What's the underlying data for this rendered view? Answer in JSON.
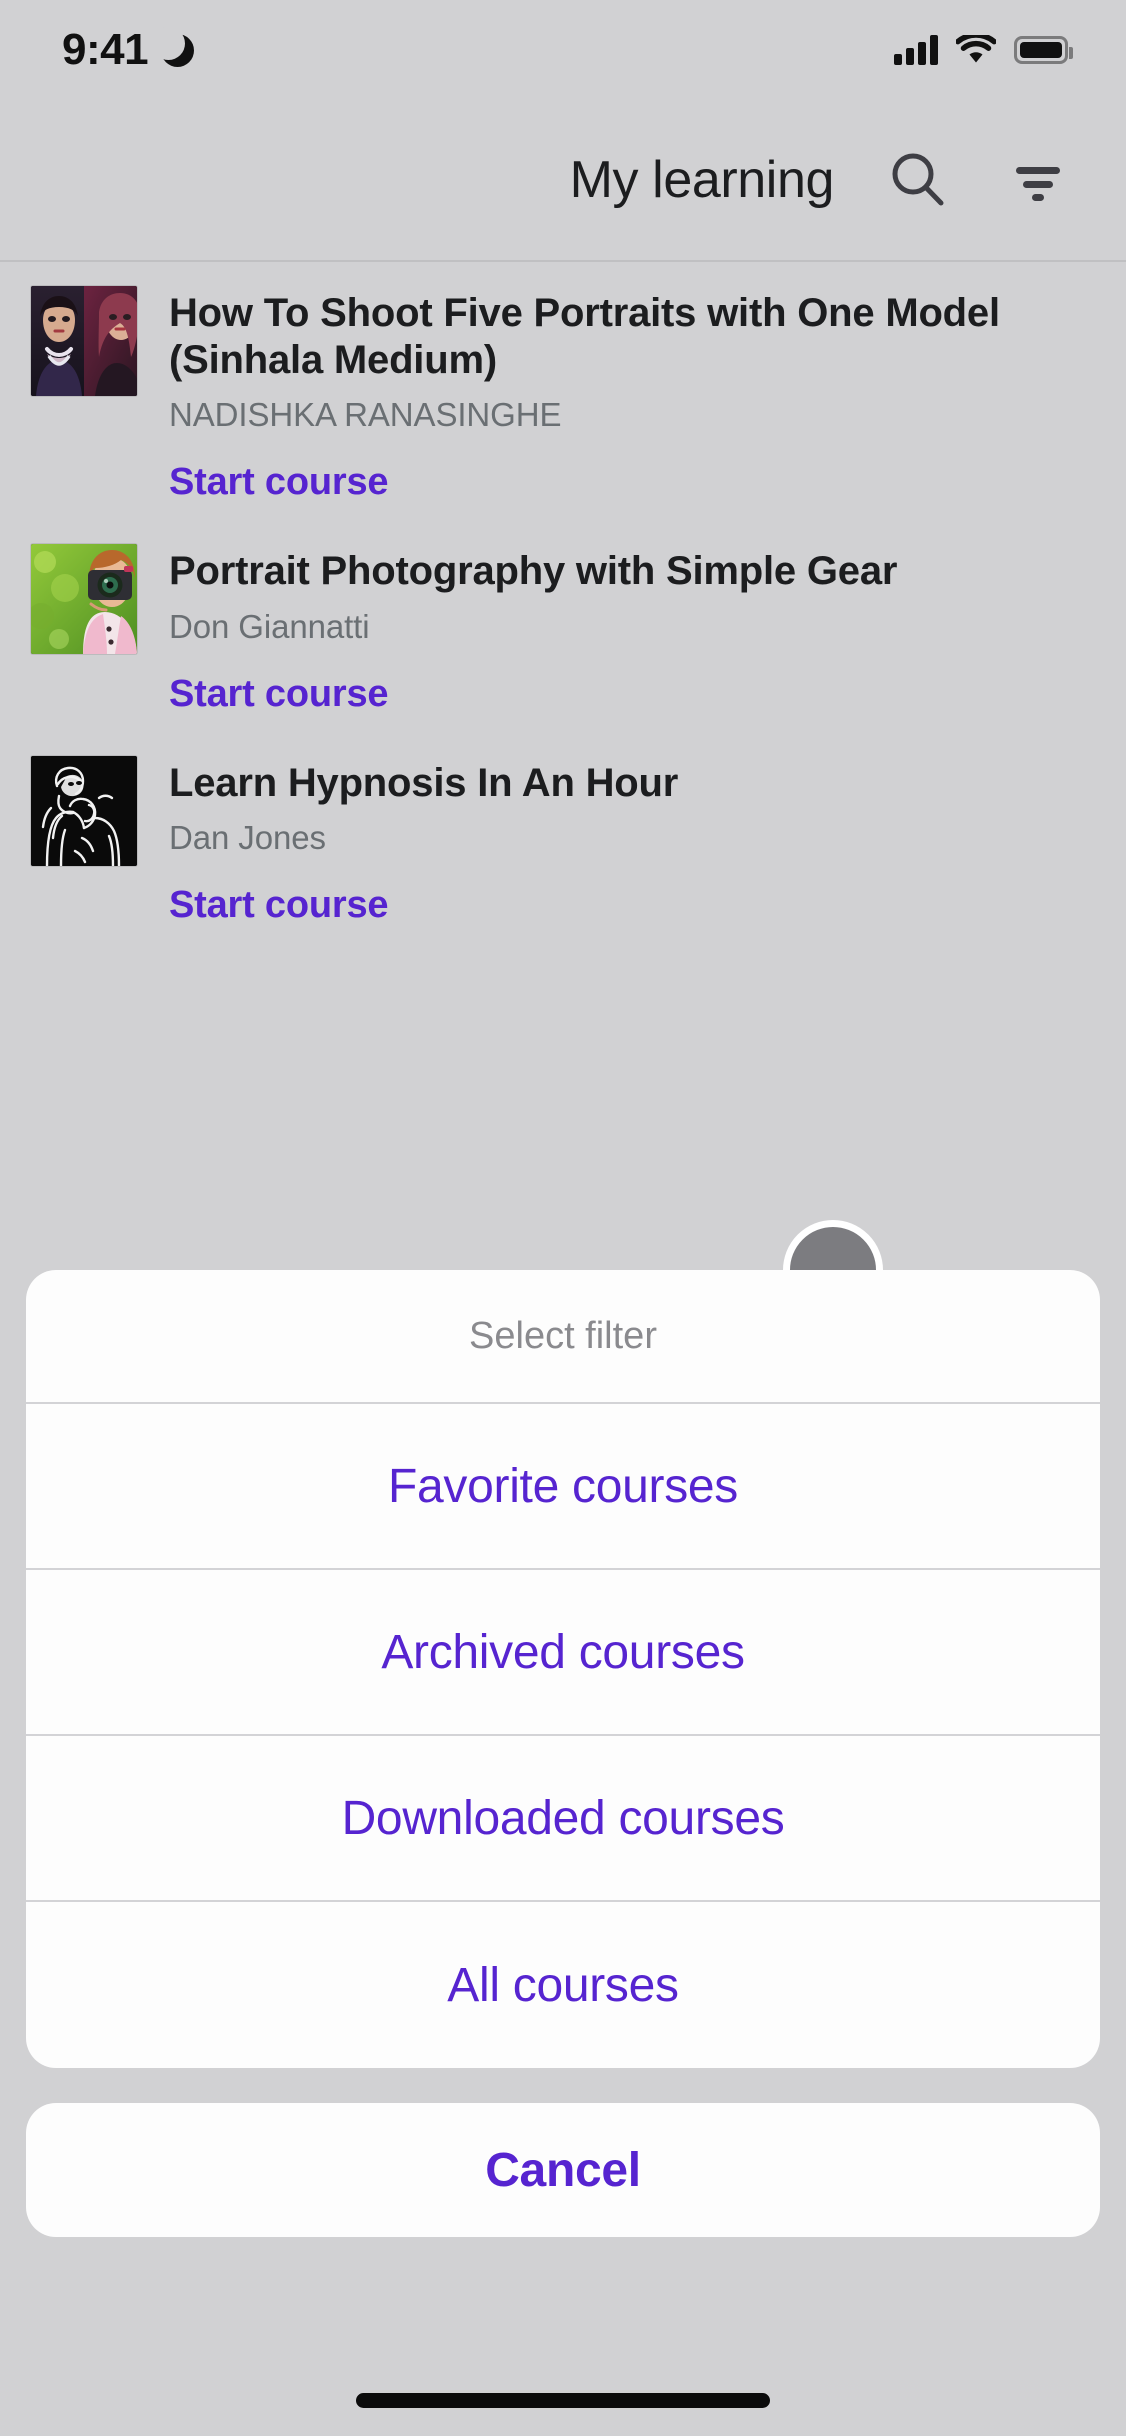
{
  "status_bar": {
    "time": "9:41",
    "dnd_icon": "moon-icon",
    "signal_icon": "cellular-signal-icon",
    "wifi_icon": "wifi-icon",
    "battery_icon": "battery-full-icon"
  },
  "header": {
    "title": "My learning",
    "search_icon": "search-icon",
    "filter_icon": "filter-icon"
  },
  "courses": [
    {
      "title": "How To Shoot Five Portraits with One Model (Sinhala Medium)",
      "author": "NADISHKA RANASINGHE",
      "action": "Start course",
      "thumbnail": "two-women-portrait-thumbnail"
    },
    {
      "title": "Portrait Photography with Simple Gear",
      "author": "Don Giannatti",
      "action": "Start course",
      "thumbnail": "woman-with-camera-thumbnail"
    },
    {
      "title": "Learn Hypnosis In An Hour",
      "author": "Dan Jones",
      "action": "Start course",
      "thumbnail": "hypnosis-line-art-thumbnail"
    }
  ],
  "action_sheet": {
    "header": "Select filter",
    "options": [
      "Favorite courses",
      "Archived courses",
      "Downloaded courses",
      "All courses"
    ],
    "cancel": "Cancel"
  },
  "colors": {
    "accent_purple": "#5624d0",
    "page_background": "#d1d1d3",
    "sheet_background": "#fdfdfd",
    "title_text": "#1c1d1f",
    "secondary_text": "#6a6f73",
    "placeholder_text": "#8a8a8e"
  },
  "touch_indicator": "touch-point-indicator",
  "home_indicator": "home-indicator-bar"
}
